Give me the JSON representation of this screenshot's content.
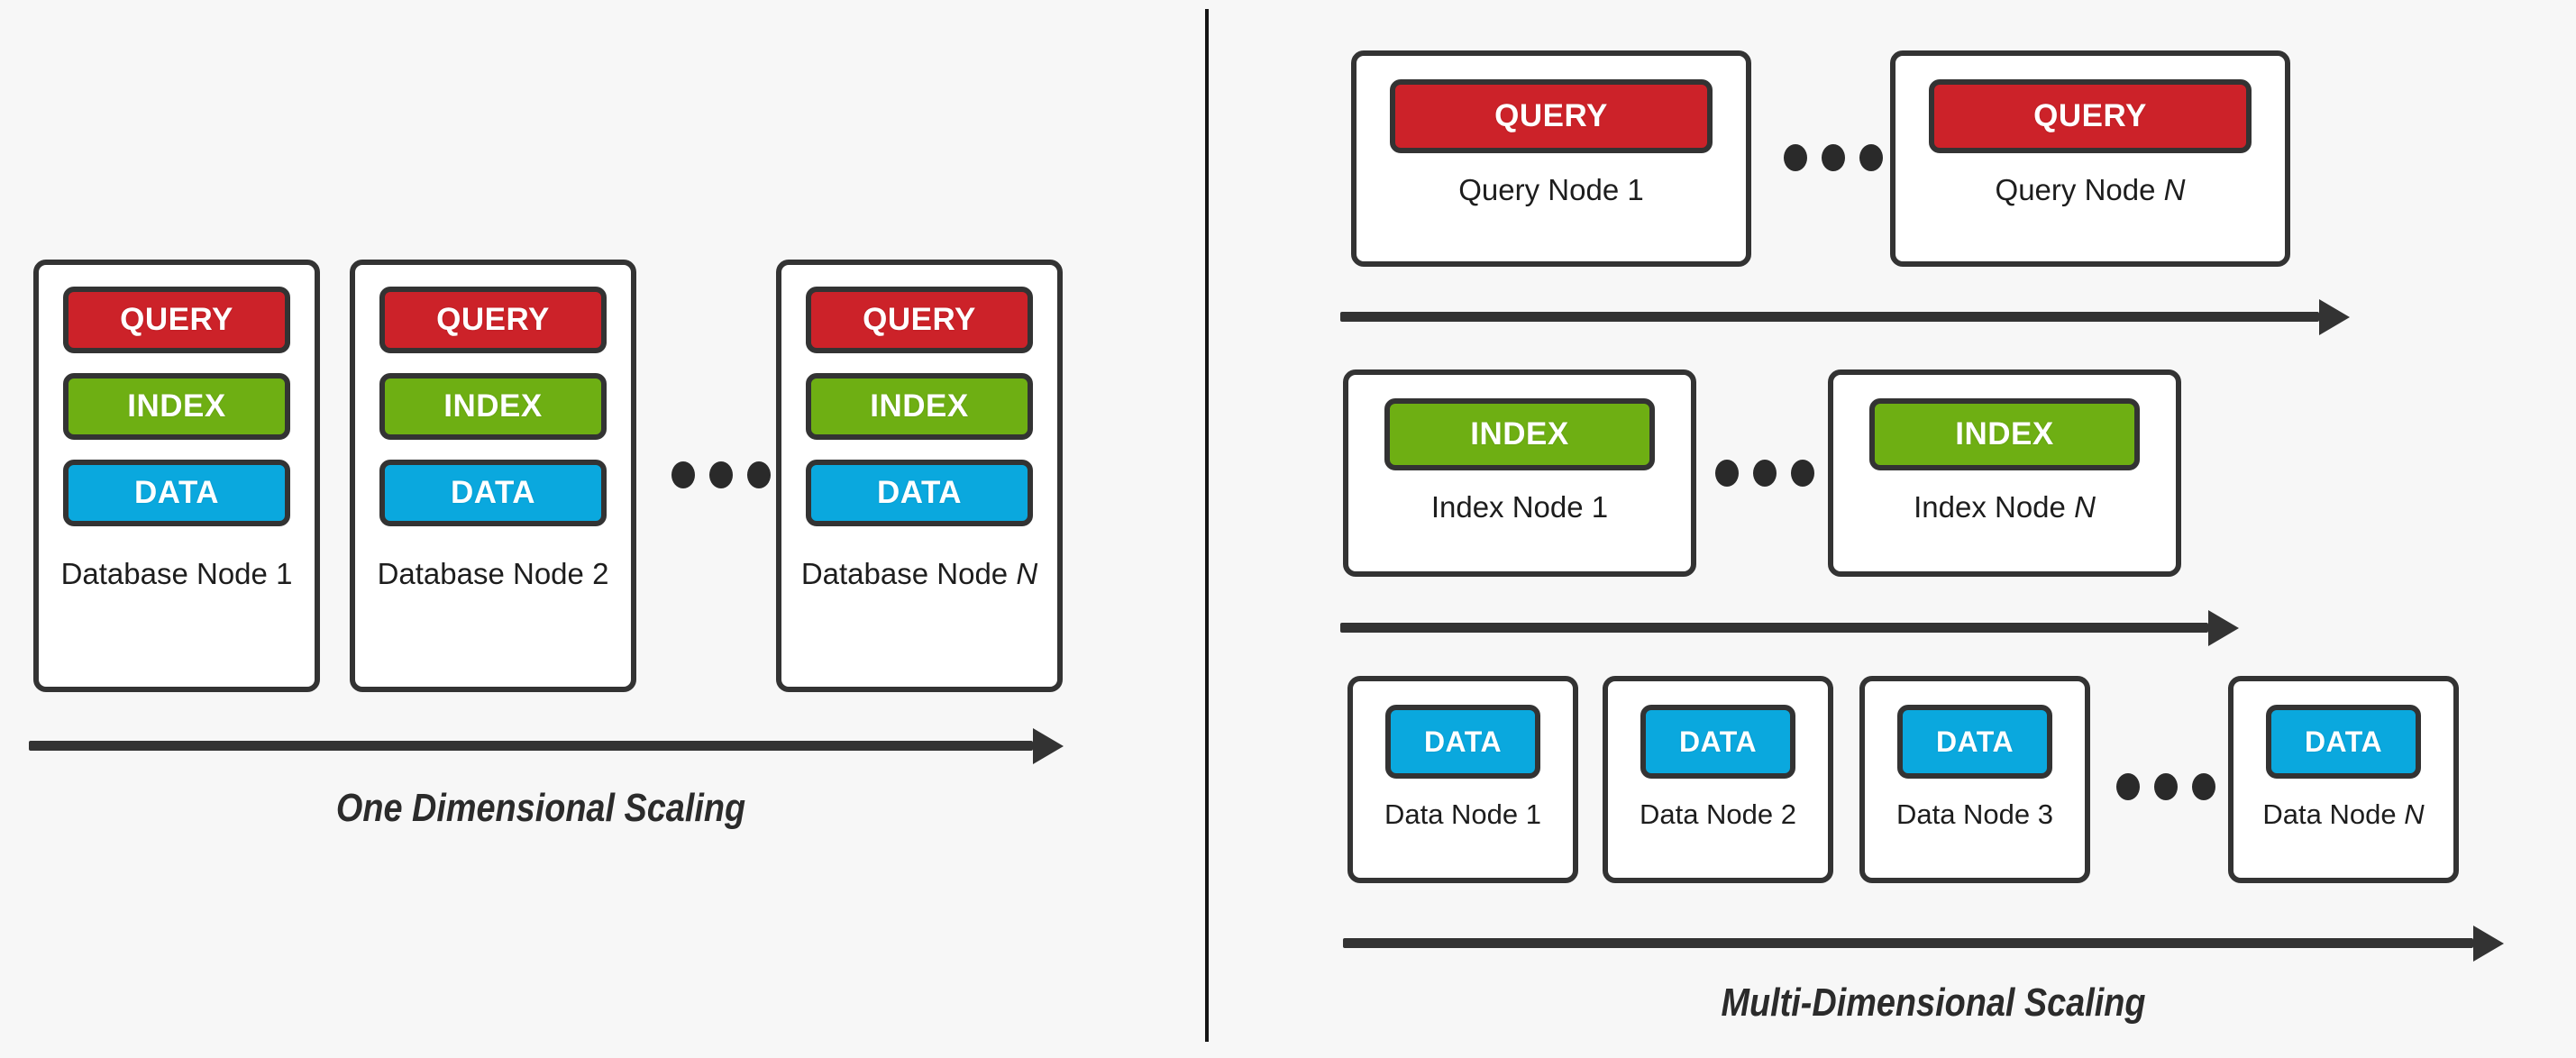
{
  "background_color": "#f7f7f7",
  "colors": {
    "query": "#cc2229",
    "index": "#6eaf13",
    "data": "#0aa8de",
    "outline": "#333333",
    "divider": "#151515",
    "text": "#1d1d1d"
  },
  "left_panel": {
    "caption": "One Dimensional Scaling",
    "ellipsis": "•••",
    "nodes": [
      {
        "label_prefix": "Database Node ",
        "label_suffix": "1",
        "suffix_italic": false,
        "chips": [
          {
            "text": "QUERY",
            "kind": "query"
          },
          {
            "text": "INDEX",
            "kind": "index"
          },
          {
            "text": "DATA",
            "kind": "data"
          }
        ]
      },
      {
        "label_prefix": "Database Node ",
        "label_suffix": "2",
        "suffix_italic": false,
        "chips": [
          {
            "text": "QUERY",
            "kind": "query"
          },
          {
            "text": "INDEX",
            "kind": "index"
          },
          {
            "text": "DATA",
            "kind": "data"
          }
        ]
      },
      {
        "label_prefix": "Database Node ",
        "label_suffix": "N",
        "suffix_italic": true,
        "chips": [
          {
            "text": "QUERY",
            "kind": "query"
          },
          {
            "text": "INDEX",
            "kind": "index"
          },
          {
            "text": "DATA",
            "kind": "data"
          }
        ]
      }
    ]
  },
  "right_panel": {
    "caption": "Multi-Dimensional Scaling",
    "ellipsis": "•••",
    "query_row": {
      "nodes": [
        {
          "label_prefix": "Query Node ",
          "label_suffix": "1",
          "suffix_italic": false,
          "chip": {
            "text": "QUERY",
            "kind": "query"
          }
        },
        {
          "label_prefix": "Query Node ",
          "label_suffix": "N",
          "suffix_italic": true,
          "chip": {
            "text": "QUERY",
            "kind": "query"
          }
        }
      ]
    },
    "index_row": {
      "nodes": [
        {
          "label_prefix": "Index Node ",
          "label_suffix": "1",
          "suffix_italic": false,
          "chip": {
            "text": "INDEX",
            "kind": "index"
          }
        },
        {
          "label_prefix": "Index Node ",
          "label_suffix": "N",
          "suffix_italic": true,
          "chip": {
            "text": "INDEX",
            "kind": "index"
          }
        }
      ]
    },
    "data_row": {
      "nodes": [
        {
          "label_prefix": "Data Node ",
          "label_suffix": "1",
          "suffix_italic": false,
          "chip": {
            "text": "DATA",
            "kind": "data"
          }
        },
        {
          "label_prefix": "Data Node ",
          "label_suffix": "2",
          "suffix_italic": false,
          "chip": {
            "text": "DATA",
            "kind": "data"
          }
        },
        {
          "label_prefix": "Data Node ",
          "label_suffix": "3",
          "suffix_italic": false,
          "chip": {
            "text": "DATA",
            "kind": "data"
          }
        },
        {
          "label_prefix": "Data Node ",
          "label_suffix": "N",
          "suffix_italic": true,
          "chip": {
            "text": "DATA",
            "kind": "data"
          }
        }
      ]
    }
  }
}
